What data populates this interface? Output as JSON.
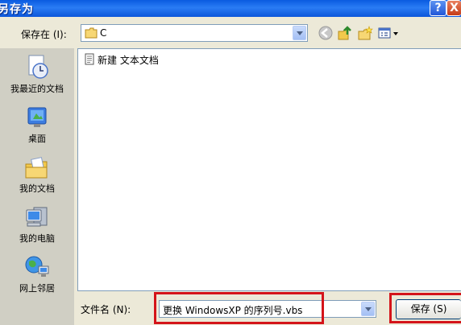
{
  "window": {
    "title": "另存为",
    "help_label": "?",
    "close_label": "X"
  },
  "toolbar": {
    "save_in_label": "保存在 (I):",
    "location_value": "C",
    "icons": [
      "back-icon",
      "up-folder-icon",
      "new-folder-icon",
      "view-menu-icon"
    ]
  },
  "places": [
    {
      "label": "我最近的文档",
      "icon": "recent-documents-icon"
    },
    {
      "label": "桌面",
      "icon": "desktop-icon"
    },
    {
      "label": "我的文档",
      "icon": "my-documents-icon"
    },
    {
      "label": "我的电脑",
      "icon": "my-computer-icon"
    },
    {
      "label": "网上邻居",
      "icon": "network-places-icon"
    }
  ],
  "files": [
    {
      "name": "新建 文本文档",
      "icon": "text-file-icon"
    }
  ],
  "bottom": {
    "filename_label": "文件名 (N):",
    "filename_value": "更换 WindowsXP 的序列号.vbs",
    "save_label": "保存 (S)"
  },
  "colors": {
    "titlebar": "#0a5be0",
    "highlight": "#d4141a",
    "dialog_bg": "#ece9d8"
  }
}
